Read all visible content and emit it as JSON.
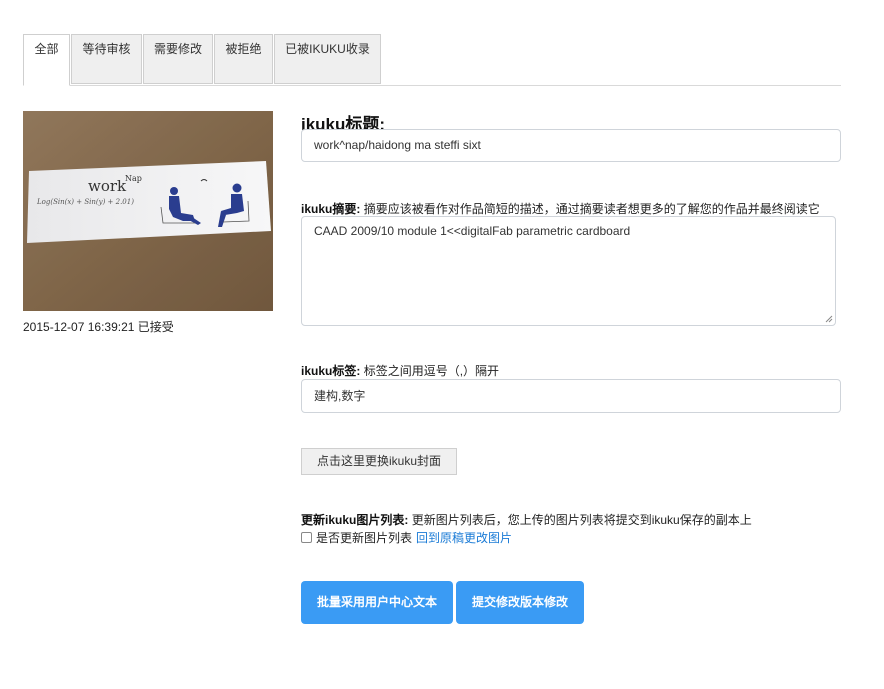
{
  "tabs": [
    {
      "label": "全部",
      "active": true
    },
    {
      "label": "等待审核",
      "active": false
    },
    {
      "label": "需要修改",
      "active": false
    },
    {
      "label": "被拒绝",
      "active": false
    },
    {
      "label": "已被IKUKU收录",
      "active": false
    }
  ],
  "cover": {
    "image_text_title": "workNap",
    "image_text_formula": "Log(Sin(x) + Sin(y) + 2.01)",
    "caption": "2015-12-07 16:39:21 已接受"
  },
  "form": {
    "title_heading": "ikuku标题:",
    "title_value": "work^nap/haidong ma steffi sixt",
    "summary_label_bold": "ikuku摘要:",
    "summary_label_hint": "摘要应该被看作对作品简短的描述，通过摘要读者想更多的了解您的作品并最终阅读它",
    "summary_value": "CAAD 2009/10 module 1<<digitalFab parametric cardboard",
    "tags_label_bold": "ikuku标签:",
    "tags_label_hint": "标签之间用逗号（,）隔开",
    "tags_value": "建构,数字",
    "change_cover_label": "点击这里更换ikuku封面",
    "update_images_label_bold": "更新ikuku图片列表:",
    "update_images_label_hint": "更新图片列表后，您上传的图片列表将提交到ikuku保存的副本上",
    "update_checkbox_label": "是否更新图片列表",
    "update_checkbox_checked": false,
    "back_to_original_link": "回到原稿更改图片"
  },
  "actions": {
    "batch_adopt_label": "批量采用用户中心文本",
    "submit_revision_label": "提交修改版本修改"
  },
  "colors": {
    "primary": "#3a9bf4",
    "link": "#1a7bd6",
    "tab_bg": "#efefef"
  }
}
